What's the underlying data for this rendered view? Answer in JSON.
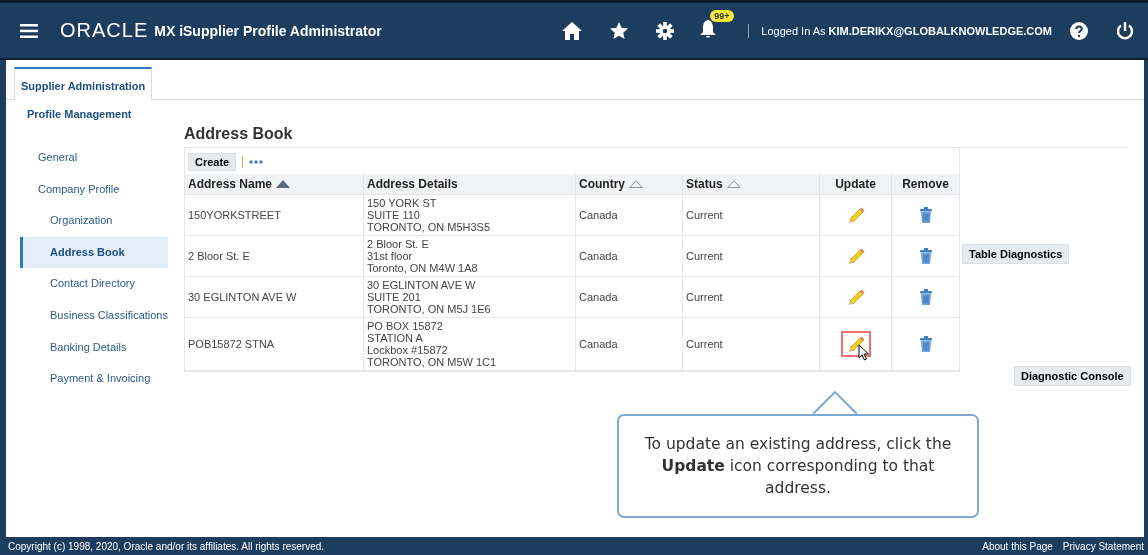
{
  "header": {
    "logo": "ORACLE",
    "app_title": "MX iSupplier Profile Administrator",
    "notification_badge": "99+",
    "logged_in": "Logged In As **KIM.DERIKX@GLOBALKNOWLEDGE.COM**"
  },
  "tabs": [
    {
      "label": "Supplier Administration",
      "selected": true
    }
  ],
  "section_title": "Profile Management",
  "sidebar": {
    "items": [
      {
        "label": "General",
        "selected": false
      },
      {
        "label": "Company Profile",
        "selected": false,
        "children": [
          {
            "label": "Organization",
            "selected": false
          },
          {
            "label": "Address Book",
            "selected": true
          },
          {
            "label": "Contact Directory",
            "selected": false
          },
          {
            "label": "Business Classifications",
            "selected": false
          },
          {
            "label": "Banking Details",
            "selected": false
          },
          {
            "label": "Payment & Invoicing",
            "selected": false
          }
        ]
      }
    ]
  },
  "page_title": "Address Book",
  "toolbar": {
    "create_button": "Create"
  },
  "table": {
    "columns": [
      {
        "label": "Address Name",
        "sortable": true,
        "sorted": true
      },
      {
        "label": "Address Details",
        "sortable": false,
        "sorted": false
      },
      {
        "label": "Country",
        "sortable": true,
        "sorted": false
      },
      {
        "label": "Status",
        "sortable": true,
        "sorted": false
      },
      {
        "label": "Update",
        "sortable": false,
        "sorted": false
      },
      {
        "label": "Remove",
        "sortable": false,
        "sorted": false
      }
    ],
    "rows": [
      {
        "name": "150YORKSTREET",
        "details": [
          "150 YORK ST",
          "SUITE 110",
          "TORONTO, ON M5H3S5"
        ],
        "country": "Canada",
        "status": "Current",
        "highlighted": false
      },
      {
        "name": "2 Bloor St. E",
        "details": [
          "2 Bloor St. E",
          "31st floor",
          "Toronto, ON M4W 1A8"
        ],
        "country": "Canada",
        "status": "Current",
        "highlighted": false
      },
      {
        "name": "30 EGLINTON AVE W",
        "details": [
          "30 EGLINTON AVE W",
          "SUITE 201",
          "TORONTO, ON M5J 1E6"
        ],
        "country": "Canada",
        "status": "Current",
        "highlighted": false
      },
      {
        "name": "POB15872 STNA",
        "details": [
          "PO BOX 15872",
          "STATION A",
          "Lockbox #15872",
          "TORONTO, ON M5W 1C1"
        ],
        "country": "Canada",
        "status": "Current",
        "highlighted": true
      }
    ]
  },
  "table_diagnostics_button": "Table Diagnostics",
  "diagnostic_console_button": "Diagnostic Console",
  "callout": "To update an existing address, click the **Update** icon corresponding to that address.",
  "footer": {
    "copyright": "Copyright (c) 1998, 2020, Oracle and/or its affiliates. All rights reserved.",
    "links": [
      "About this Page",
      "Privacy Statement"
    ]
  }
}
